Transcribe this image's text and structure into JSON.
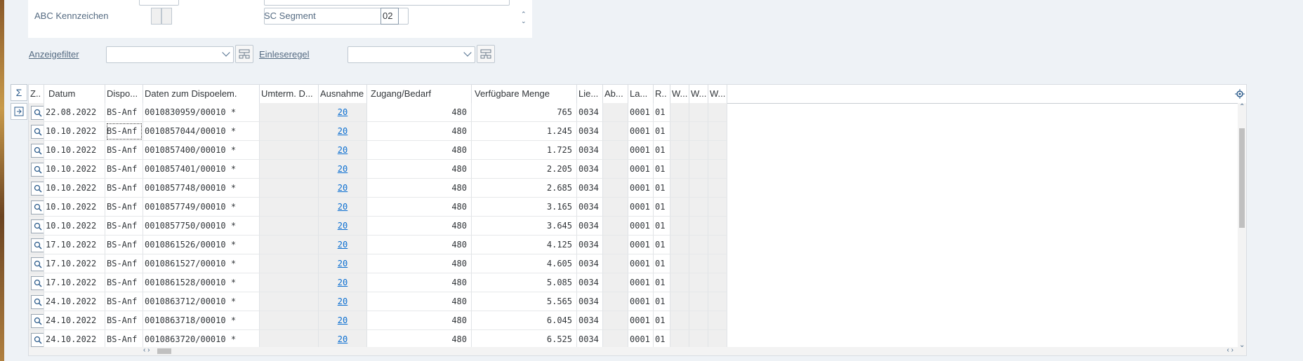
{
  "colors": {
    "link": "#0a6ed1",
    "label": "#556b82",
    "gray_cell": "#efefef"
  },
  "top_panel": {
    "abc_label": "ABC Kennzeichen",
    "sc_segment_label": "SC Segment",
    "sc_segment_value": "02"
  },
  "filters": {
    "display_filter_label": "Anzeigefilter",
    "display_filter_value": "",
    "read_rule_label": "Einleseregel",
    "read_rule_value": ""
  },
  "side_buttons": {
    "sum_icon": "Σ"
  },
  "grid": {
    "columns": [
      "Z..",
      "Datum",
      "Dispo...",
      "Daten zum Dispoelem.",
      "Umterm. D...",
      "Ausnahme",
      "Zugang/Bedarf",
      "Verfügbare Menge",
      "Lie...",
      "Ab...",
      "La...",
      "R..",
      "W...",
      "W...",
      "W..."
    ],
    "rows": [
      {
        "datum": "22.08.2022",
        "dispo": "BS-Anf",
        "daten": "0010830959/00010 *",
        "ausnahme": "20",
        "zugang": "480",
        "menge": "765",
        "lie": "0034",
        "la": "0001",
        "r": "01"
      },
      {
        "datum": "10.10.2022",
        "dispo": "BS-Anf",
        "daten": "0010857044/00010 *",
        "ausnahme": "20",
        "zugang": "480",
        "menge": "1.245",
        "lie": "0034",
        "la": "0001",
        "r": "01"
      },
      {
        "datum": "10.10.2022",
        "dispo": "BS-Anf",
        "daten": "0010857400/00010 *",
        "ausnahme": "20",
        "zugang": "480",
        "menge": "1.725",
        "lie": "0034",
        "la": "0001",
        "r": "01"
      },
      {
        "datum": "10.10.2022",
        "dispo": "BS-Anf",
        "daten": "0010857401/00010 *",
        "ausnahme": "20",
        "zugang": "480",
        "menge": "2.205",
        "lie": "0034",
        "la": "0001",
        "r": "01"
      },
      {
        "datum": "10.10.2022",
        "dispo": "BS-Anf",
        "daten": "0010857748/00010 *",
        "ausnahme": "20",
        "zugang": "480",
        "menge": "2.685",
        "lie": "0034",
        "la": "0001",
        "r": "01"
      },
      {
        "datum": "10.10.2022",
        "dispo": "BS-Anf",
        "daten": "0010857749/00010 *",
        "ausnahme": "20",
        "zugang": "480",
        "menge": "3.165",
        "lie": "0034",
        "la": "0001",
        "r": "01"
      },
      {
        "datum": "10.10.2022",
        "dispo": "BS-Anf",
        "daten": "0010857750/00010 *",
        "ausnahme": "20",
        "zugang": "480",
        "menge": "3.645",
        "lie": "0034",
        "la": "0001",
        "r": "01"
      },
      {
        "datum": "17.10.2022",
        "dispo": "BS-Anf",
        "daten": "0010861526/00010 *",
        "ausnahme": "20",
        "zugang": "480",
        "menge": "4.125",
        "lie": "0034",
        "la": "0001",
        "r": "01"
      },
      {
        "datum": "17.10.2022",
        "dispo": "BS-Anf",
        "daten": "0010861527/00010 *",
        "ausnahme": "20",
        "zugang": "480",
        "menge": "4.605",
        "lie": "0034",
        "la": "0001",
        "r": "01"
      },
      {
        "datum": "17.10.2022",
        "dispo": "BS-Anf",
        "daten": "0010861528/00010 *",
        "ausnahme": "20",
        "zugang": "480",
        "menge": "5.085",
        "lie": "0034",
        "la": "0001",
        "r": "01"
      },
      {
        "datum": "24.10.2022",
        "dispo": "BS-Anf",
        "daten": "0010863712/00010 *",
        "ausnahme": "20",
        "zugang": "480",
        "menge": "5.565",
        "lie": "0034",
        "la": "0001",
        "r": "01"
      },
      {
        "datum": "24.10.2022",
        "dispo": "BS-Anf",
        "daten": "0010863718/00010 *",
        "ausnahme": "20",
        "zugang": "480",
        "menge": "6.045",
        "lie": "0034",
        "la": "0001",
        "r": "01"
      },
      {
        "datum": "24.10.2022",
        "dispo": "BS-Anf",
        "daten": "0010863720/00010 *",
        "ausnahme": "20",
        "zugang": "480",
        "menge": "6.525",
        "lie": "0034",
        "la": "0001",
        "r": "01"
      }
    ]
  }
}
